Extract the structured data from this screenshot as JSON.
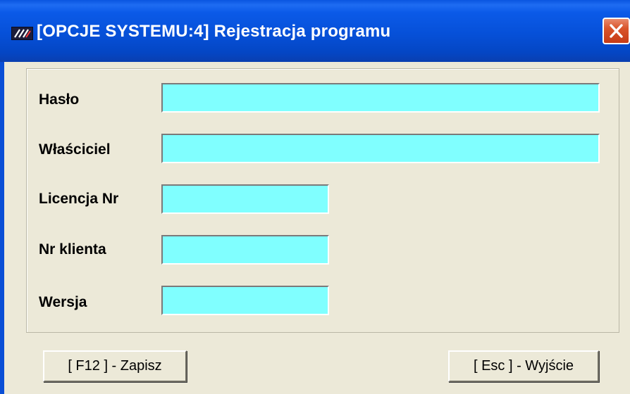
{
  "window": {
    "title": "[OPCJE SYSTEMU:4]  Rejestracja programu"
  },
  "colors": {
    "titlebar": "#0650d8",
    "field_background": "#80ffff",
    "window_background": "#ece9d8",
    "close_button": "#d9542a"
  },
  "icons": {
    "app": "app-logo-icon",
    "close": "close-icon"
  },
  "form": {
    "fields": [
      {
        "label": "Hasło",
        "value": ""
      },
      {
        "label": "Właściciel",
        "value": ""
      },
      {
        "label": "Licencja Nr",
        "value": ""
      },
      {
        "label": "Nr klienta",
        "value": ""
      },
      {
        "label": "Wersja",
        "value": ""
      }
    ]
  },
  "buttons": {
    "save_label": "[ F12 ] - Zapisz",
    "exit_label": "[ Esc ] - Wyjście"
  }
}
